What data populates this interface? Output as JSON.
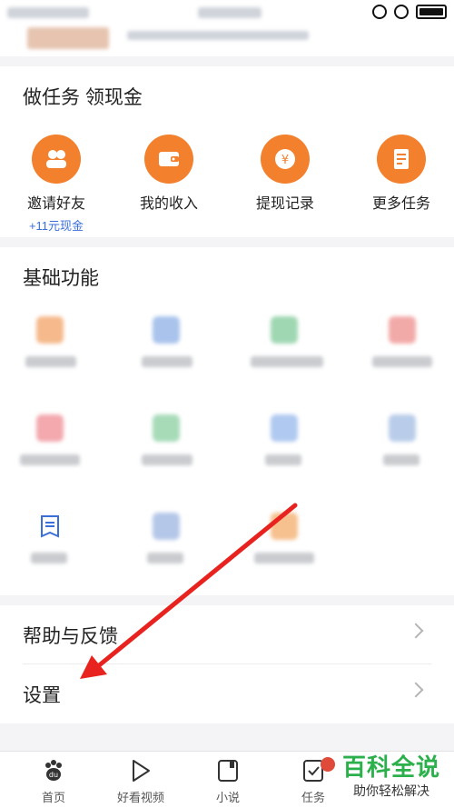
{
  "task_section": {
    "title": "做任务  领现金",
    "items": [
      {
        "label": "邀请好友",
        "sub": "+11元现金",
        "icon": "invite-friends-icon"
      },
      {
        "label": "我的收入",
        "icon": "wallet-icon"
      },
      {
        "label": "提现记录",
        "icon": "withdraw-record-icon"
      },
      {
        "label": "更多任务",
        "icon": "more-tasks-icon"
      }
    ]
  },
  "basic_section": {
    "title": "基础功能"
  },
  "menu": {
    "help_label": "帮助与反馈",
    "settings_label": "设置"
  },
  "bottom_nav": {
    "items": [
      {
        "label": "首页",
        "icon": "paw-icon"
      },
      {
        "label": "好看视频",
        "icon": "play-icon"
      },
      {
        "label": "小说",
        "icon": "book-icon"
      },
      {
        "label": "任务",
        "icon": "task-check-icon"
      }
    ]
  },
  "watermark": {
    "main": "百科全说",
    "sub": "助你轻松解决"
  },
  "colors": {
    "accent_orange": "#f3802c",
    "link_blue": "#3b6fd8",
    "arrow_red": "#e8231f",
    "watermark_green": "#2bb04b"
  }
}
